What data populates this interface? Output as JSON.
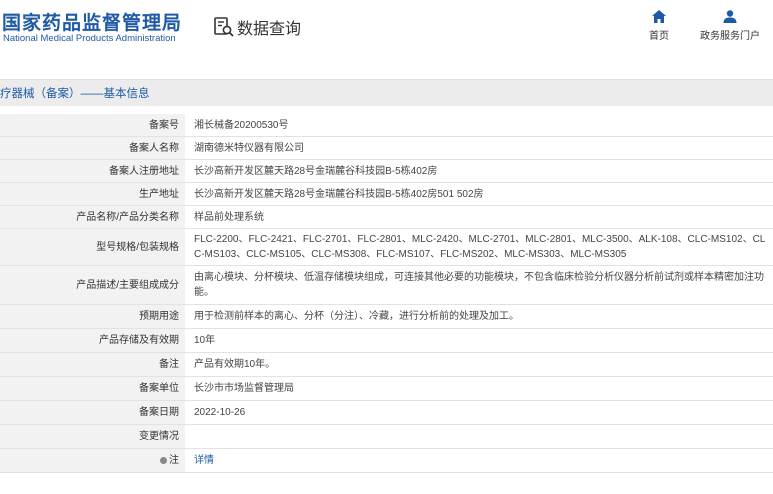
{
  "header": {
    "logo_cn": "国家药品监督管理局",
    "logo_en": "National Medical Products Administration",
    "query_label": "数据查询",
    "nav": [
      {
        "label": "首页",
        "icon": "home-icon"
      },
      {
        "label": "政务服务门户",
        "icon": "user-icon"
      }
    ]
  },
  "breadcrumb": "疗器械（备案）——基本信息",
  "rows": [
    {
      "label": "备案号",
      "value": "湘长械备20200530号"
    },
    {
      "label": "备案人名称",
      "value": "湖南德米特仪器有限公司"
    },
    {
      "label": "备案人注册地址",
      "value": "长沙高新开发区麓天路28号金瑞麓谷科技园B-5栋402房"
    },
    {
      "label": "生产地址",
      "value": "长沙高新开发区麓天路28号金瑞麓谷科技园B-5栋402房501 502房"
    },
    {
      "label": "产品名称/产品分类名称",
      "value": "样品前处理系统"
    },
    {
      "label": "型号规格/包装规格",
      "value": "FLC-2200、FLC-2421、FLC-2701、FLC-2801、MLC-2420、MLC-2701、MLC-2801、MLC-3500、ALK-108、CLC-MS102、CLC-MS103、CLC-MS105、CLC-MS308、FLC-MS107、FLC-MS202、MLC-MS303、MLC-MS305"
    },
    {
      "label": "产品描述/主要组成成分",
      "value": "由离心模块、分杯模块、低温存储模块组成，可连接其他必要的功能模块，不包含临床检验分析仪器分析前试剂或样本精密加注功能。"
    },
    {
      "label": "预期用途",
      "value": "用于检测前样本的离心、分杯（分注）、冷藏，进行分析前的处理及加工。"
    },
    {
      "label": "产品存储及有效期",
      "value": "10年"
    },
    {
      "label": "备注",
      "value": "产品有效期10年。"
    },
    {
      "label": "备案单位",
      "value": "长沙市市场监督管理局"
    },
    {
      "label": "备案日期",
      "value": "2022-10-26"
    },
    {
      "label": "变更情况",
      "value": ""
    }
  ],
  "note_row": {
    "label": "注",
    "link": "详情"
  },
  "colors": {
    "brand": "#1f5aa6",
    "label_bg": "#f2f2f2",
    "border": "#e2e2e2"
  }
}
